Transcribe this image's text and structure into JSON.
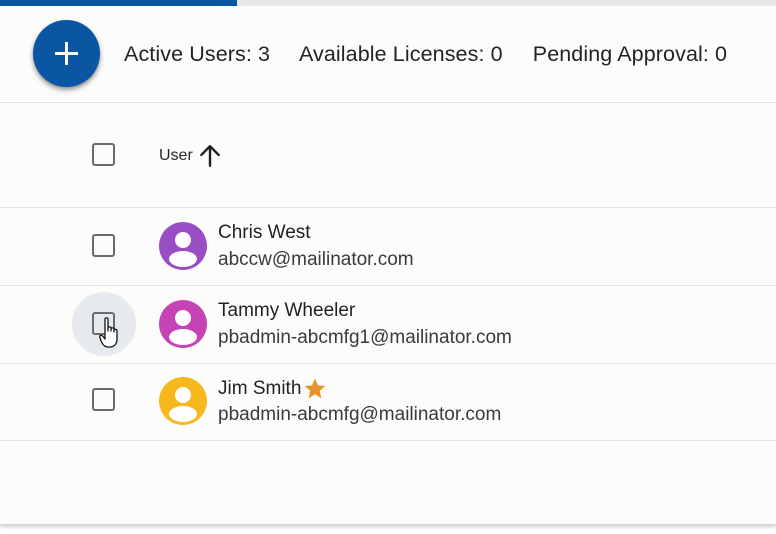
{
  "progress": {
    "fraction": 0.305,
    "color": "#0a56a3"
  },
  "toolbar": {
    "add_icon": "plus-icon",
    "stats": [
      {
        "label": "Active Users: 3"
      },
      {
        "label": "Available Licenses: 0"
      },
      {
        "label": "Pending Approval: 0"
      }
    ]
  },
  "table": {
    "header": {
      "column_label": "User",
      "sort_icon": "arrow-up-icon",
      "sort_direction": "ascending"
    },
    "rows": [
      {
        "name": "Chris West",
        "email": "abccw@mailinator.com",
        "avatar_color": "#9a4ec5",
        "starred": false,
        "hovered": false
      },
      {
        "name": "Tammy Wheeler",
        "email": "pbadmin-abcmfg1@mailinator.com",
        "avatar_color": "#c543b4",
        "starred": false,
        "hovered": true
      },
      {
        "name": "Jim Smith",
        "email": "pbadmin-abcmfg@mailinator.com",
        "avatar_color": "#f6b81c",
        "starred": true,
        "hovered": false
      }
    ]
  },
  "colors": {
    "accent": "#0a56a3",
    "star": "#e8922a"
  }
}
